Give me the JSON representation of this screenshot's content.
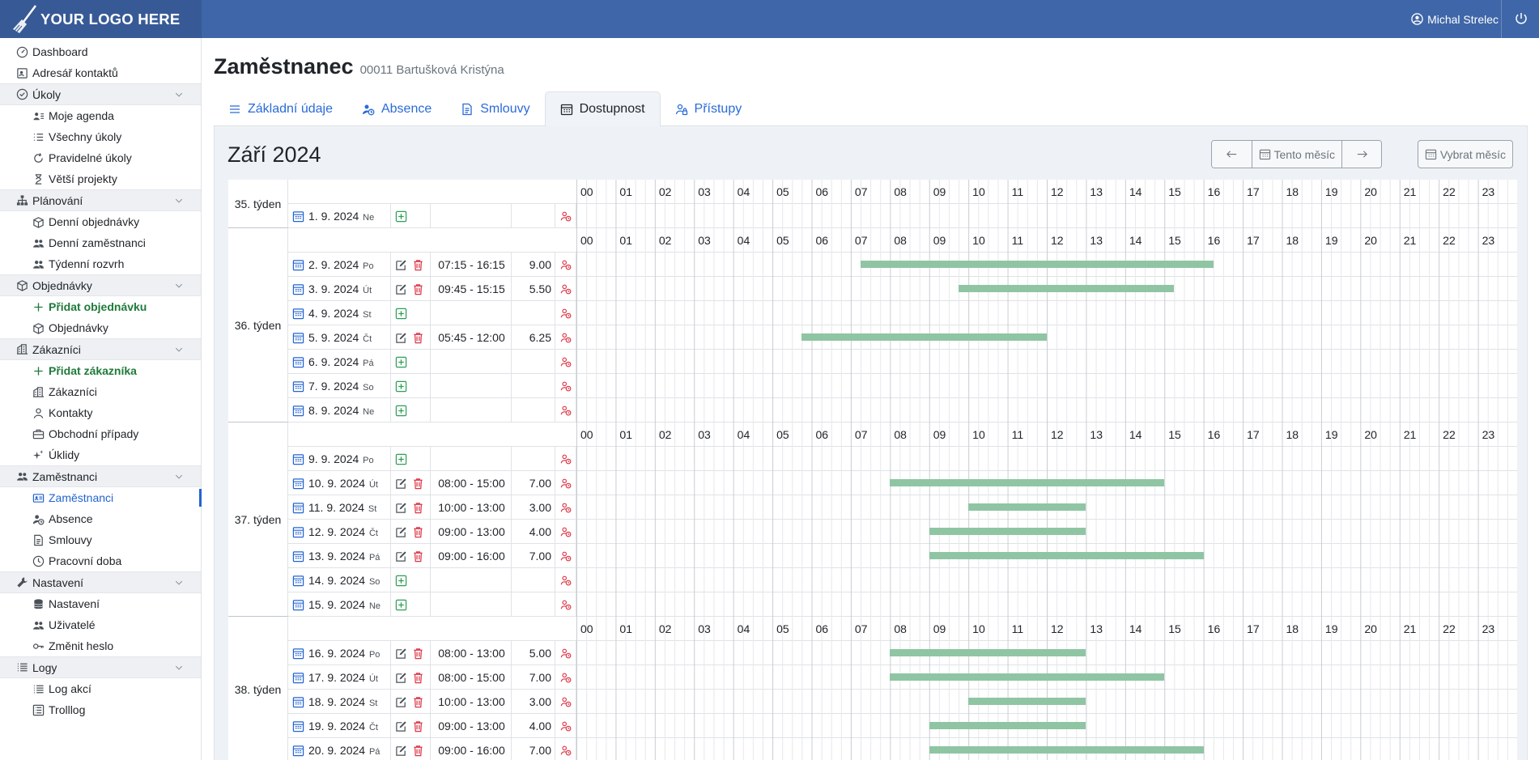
{
  "app": {
    "logo_text": "YOUR LOGO HERE",
    "user_name": "Michal Strelec"
  },
  "sidebar": {
    "items": [
      {
        "label": "Dashboard",
        "kind": "top",
        "icon": "dashboard-icon"
      },
      {
        "label": "Adresář kontaktů",
        "kind": "top",
        "icon": "address-book-icon"
      },
      {
        "label": "Úkoly",
        "kind": "group",
        "icon": "check-circle-icon"
      },
      {
        "label": "Moje agenda",
        "kind": "sub",
        "icon": "user-list-icon"
      },
      {
        "label": "Všechny úkoly",
        "kind": "sub",
        "icon": "list-check-icon"
      },
      {
        "label": "Pravidelné úkoly",
        "kind": "sub",
        "icon": "refresh-icon"
      },
      {
        "label": "Větší projekty",
        "kind": "sub",
        "icon": "hourglass-icon"
      },
      {
        "label": "Plánování",
        "kind": "group",
        "icon": "sitemap-icon"
      },
      {
        "label": "Denní objednávky",
        "kind": "sub",
        "icon": "box-icon"
      },
      {
        "label": "Denní zaměstnanci",
        "kind": "sub",
        "icon": "users-icon"
      },
      {
        "label": "Týdenní rozvrh",
        "kind": "sub",
        "icon": "users-icon"
      },
      {
        "label": "Objednávky",
        "kind": "group",
        "icon": "box-icon"
      },
      {
        "label": "Přidat objednávku",
        "kind": "sub",
        "icon": "plus-icon",
        "style": "green"
      },
      {
        "label": "Objednávky",
        "kind": "sub",
        "icon": "box-icon"
      },
      {
        "label": "Zákazníci",
        "kind": "group",
        "icon": "building-icon"
      },
      {
        "label": "Přidat zákazníka",
        "kind": "sub",
        "icon": "plus-icon",
        "style": "green"
      },
      {
        "label": "Zákazníci",
        "kind": "sub",
        "icon": "building-icon"
      },
      {
        "label": "Kontakty",
        "kind": "sub",
        "icon": "user-icon"
      },
      {
        "label": "Obchodní případy",
        "kind": "sub",
        "icon": "briefcase-icon"
      },
      {
        "label": "Úklidy",
        "kind": "sub",
        "icon": "sparkle-icon"
      },
      {
        "label": "Zaměstnanci",
        "kind": "group",
        "icon": "users-icon"
      },
      {
        "label": "Zaměstnanci",
        "kind": "sub",
        "icon": "id-card-icon",
        "style": "active"
      },
      {
        "label": "Absence",
        "kind": "sub",
        "icon": "user-clock-icon"
      },
      {
        "label": "Smlouvy",
        "kind": "sub",
        "icon": "document-icon"
      },
      {
        "label": "Pracovní doba",
        "kind": "sub",
        "icon": "clock-icon"
      },
      {
        "label": "Nastavení",
        "kind": "group",
        "icon": "wrench-icon"
      },
      {
        "label": "Nastavení",
        "kind": "sub",
        "icon": "database-icon"
      },
      {
        "label": "Uživatelé",
        "kind": "sub",
        "icon": "users-icon"
      },
      {
        "label": "Změnit heslo",
        "kind": "sub",
        "icon": "key-icon"
      },
      {
        "label": "Logy",
        "kind": "group",
        "icon": "list-icon"
      },
      {
        "label": "Log akcí",
        "kind": "sub",
        "icon": "list-icon"
      },
      {
        "label": "Trolllog",
        "kind": "sub",
        "icon": "list-alt-icon"
      }
    ]
  },
  "page": {
    "title": "Zaměstnanec",
    "subtitle": "00011 Bartušková Kristýna",
    "tabs": [
      {
        "label": "Základní údaje",
        "icon": "lines-icon"
      },
      {
        "label": "Absence",
        "icon": "user-clock-icon"
      },
      {
        "label": "Smlouvy",
        "icon": "document-icon"
      },
      {
        "label": "Dostupnost",
        "icon": "calendar-icon",
        "active": true
      },
      {
        "label": "Přístupy",
        "icon": "user-lock-icon"
      }
    ]
  },
  "calendar": {
    "month_title": "Září 2024",
    "this_month_label": "Tento měsíc",
    "pick_month_label": "Vybrat měsíc",
    "hours": [
      "00",
      "01",
      "02",
      "03",
      "04",
      "05",
      "06",
      "07",
      "08",
      "09",
      "10",
      "11",
      "12",
      "13",
      "14",
      "15",
      "16",
      "17",
      "18",
      "19",
      "20",
      "21",
      "22",
      "23"
    ],
    "weeks": [
      {
        "label": "35. týden",
        "days": [
          {
            "date": "1. 9. 2024",
            "dow": "Ne",
            "time": "",
            "hours": "",
            "start": null,
            "end": null
          }
        ]
      },
      {
        "label": "36. týden",
        "days": [
          {
            "date": "2. 9. 2024",
            "dow": "Po",
            "time": "07:15 - 16:15",
            "hours": "9.00",
            "start": 7.25,
            "end": 16.25
          },
          {
            "date": "3. 9. 2024",
            "dow": "Út",
            "time": "09:45 - 15:15",
            "hours": "5.50",
            "start": 9.75,
            "end": 15.25
          },
          {
            "date": "4. 9. 2024",
            "dow": "St",
            "time": "",
            "hours": "",
            "start": null,
            "end": null
          },
          {
            "date": "5. 9. 2024",
            "dow": "Čt",
            "time": "05:45 - 12:00",
            "hours": "6.25",
            "start": 5.75,
            "end": 12.0
          },
          {
            "date": "6. 9. 2024",
            "dow": "Pá",
            "time": "",
            "hours": "",
            "start": null,
            "end": null
          },
          {
            "date": "7. 9. 2024",
            "dow": "So",
            "time": "",
            "hours": "",
            "start": null,
            "end": null
          },
          {
            "date": "8. 9. 2024",
            "dow": "Ne",
            "time": "",
            "hours": "",
            "start": null,
            "end": null
          }
        ]
      },
      {
        "label": "37. týden",
        "days": [
          {
            "date": "9. 9. 2024",
            "dow": "Po",
            "time": "",
            "hours": "",
            "start": null,
            "end": null
          },
          {
            "date": "10. 9. 2024",
            "dow": "Út",
            "time": "08:00 - 15:00",
            "hours": "7.00",
            "start": 8.0,
            "end": 15.0
          },
          {
            "date": "11. 9. 2024",
            "dow": "St",
            "time": "10:00 - 13:00",
            "hours": "3.00",
            "start": 10.0,
            "end": 13.0
          },
          {
            "date": "12. 9. 2024",
            "dow": "Čt",
            "time": "09:00 - 13:00",
            "hours": "4.00",
            "start": 9.0,
            "end": 13.0
          },
          {
            "date": "13. 9. 2024",
            "dow": "Pá",
            "time": "09:00 - 16:00",
            "hours": "7.00",
            "start": 9.0,
            "end": 16.0
          },
          {
            "date": "14. 9. 2024",
            "dow": "So",
            "time": "",
            "hours": "",
            "start": null,
            "end": null
          },
          {
            "date": "15. 9. 2024",
            "dow": "Ne",
            "time": "",
            "hours": "",
            "start": null,
            "end": null
          }
        ]
      },
      {
        "label": "38. týden",
        "days": [
          {
            "date": "16. 9. 2024",
            "dow": "Po",
            "time": "08:00 - 13:00",
            "hours": "5.00",
            "start": 8.0,
            "end": 13.0
          },
          {
            "date": "17. 9. 2024",
            "dow": "Út",
            "time": "08:00 - 15:00",
            "hours": "7.00",
            "start": 8.0,
            "end": 15.0
          },
          {
            "date": "18. 9. 2024",
            "dow": "St",
            "time": "10:00 - 13:00",
            "hours": "3.00",
            "start": 10.0,
            "end": 13.0
          },
          {
            "date": "19. 9. 2024",
            "dow": "Čt",
            "time": "09:00 - 13:00",
            "hours": "4.00",
            "start": 9.0,
            "end": 13.0
          },
          {
            "date": "20. 9. 2024",
            "dow": "Pá",
            "time": "09:00 - 16:00",
            "hours": "7.00",
            "start": 9.0,
            "end": 16.0
          }
        ]
      }
    ],
    "colors": {
      "bar": "#8fc5a3",
      "add": "#2f9e55",
      "delete": "#dc3545",
      "accent": "#2264d1"
    }
  }
}
